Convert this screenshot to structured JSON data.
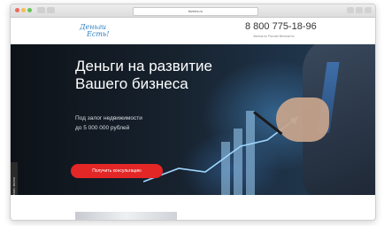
{
  "browser": {
    "address": "biznes.ru"
  },
  "header": {
    "logo_line1": "Деньги",
    "logo_line2": "Есть!",
    "phone": "8 800 775-18-96",
    "phone_caption": "Звонок по России бесплатно"
  },
  "hero": {
    "title_line1": "Деньги на развитие",
    "title_line2": "Вашего бизнеса",
    "subtitle_line1": "Под залог недвижимости",
    "subtitle_line2": "до 5 000 000 рублей",
    "cta_label": "Получить консультацию"
  },
  "side_tab": {
    "label": "Заказать звонок"
  },
  "colors": {
    "cta": "#e32626",
    "logo": "#2c7fc4",
    "hero_bg": "#17222e"
  }
}
